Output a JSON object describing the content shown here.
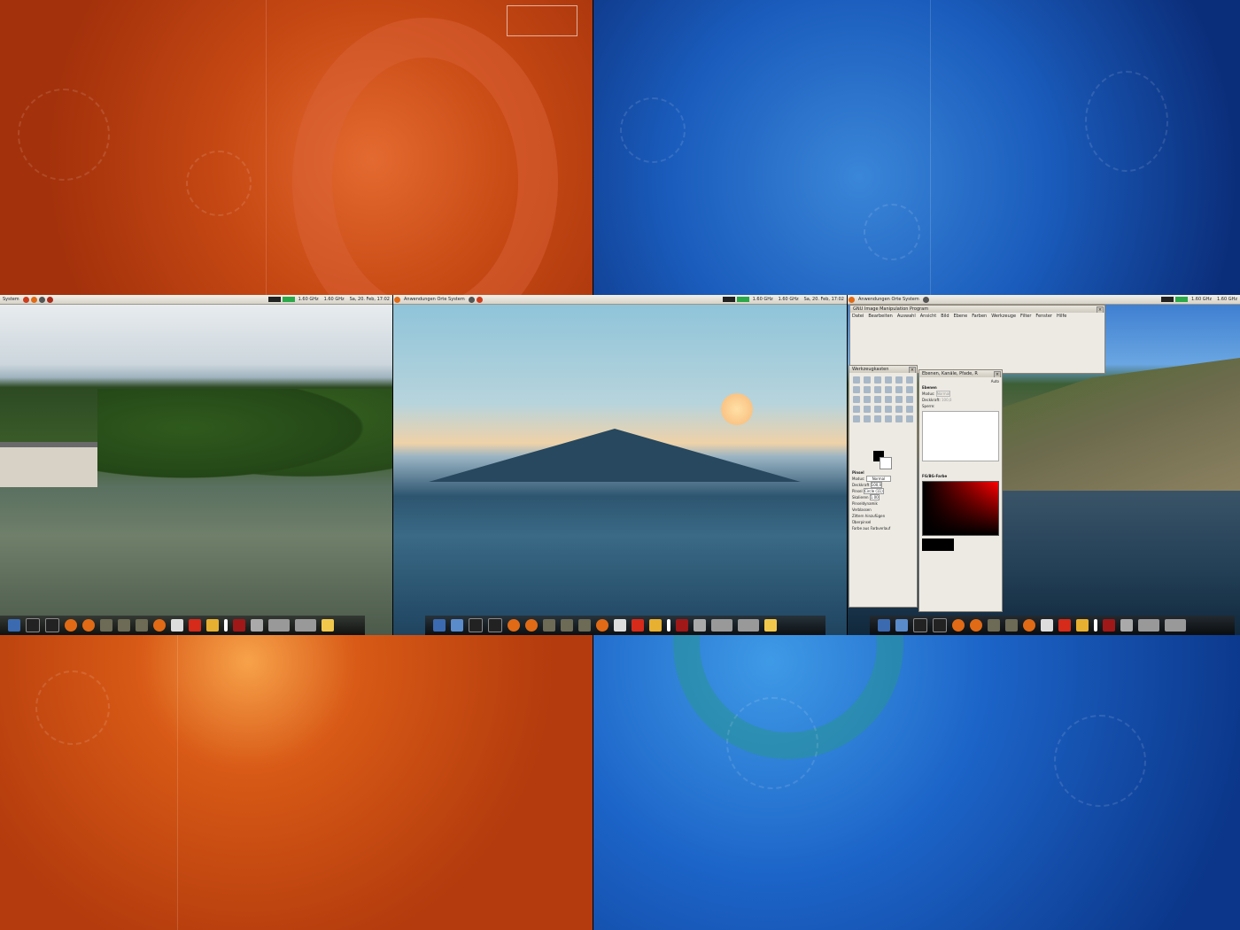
{
  "panels": [
    {
      "left": "System",
      "clock": "Sa, 20. Feb, 17:02",
      "cpu1": "1.60 GHz",
      "cpu2": "1.60 GHz"
    },
    {
      "left": "Anwendungen   Orte   System",
      "clock": "Sa, 20. Feb, 17:02",
      "cpu1": "1.60 GHz",
      "cpu2": "1.60 GHz"
    },
    {
      "left": "Anwendungen   Orte   System",
      "clock": "",
      "cpu1": "1.60 GHz",
      "cpu2": "1.60 GHz"
    }
  ],
  "gimp": {
    "title": "GNU Image Manipulation Program",
    "menu": [
      "Datei",
      "Bearbeiten",
      "Auswahl",
      "Ansicht",
      "Bild",
      "Ebene",
      "Farben",
      "Werkzeuge",
      "Filter",
      "Fenster",
      "Hilfe"
    ],
    "toolbox_title": "Werkzeugkasten",
    "tool_section": "Pinsel",
    "mode_label": "Modus:",
    "mode_value": "Normal",
    "opacity_label": "Deckkraft",
    "opacity_value": "100,0",
    "brush_label": "Pinsel",
    "brush_value": "Circle (11)",
    "scale_label": "Skalieren",
    "scale_value": "1.00",
    "options": [
      "Pinseldynamik",
      "Verblassen",
      "Zittern hinzufügen",
      "Überpinsel",
      "Farbe aus Farbverlauf"
    ],
    "layers_title": "Ebenen, Kanäle, Pfade, R",
    "layers_auto": "Auto",
    "layers_label": "Ebenen",
    "layers_mode_label": "Modus:",
    "layers_mode_value": "Normal",
    "layers_opacity_label": "Deckkraft:",
    "layers_opacity_value": "100,0",
    "layers_lock_label": "Sperre:",
    "color_label": "FG/BG-Farbe"
  },
  "icons": {
    "dock": [
      "disk-icon",
      "bird-icon",
      "terminal-icon",
      "terminal-icon",
      "firefox-icon",
      "firefox-icon",
      "turtle-icon",
      "turtle-icon",
      "turtle-icon",
      "ubuntu-icon",
      "chef-icon",
      "power-icon",
      "folder-icon",
      "down-icon",
      "image-icon",
      "trash-icon",
      "screen-icon",
      "workspace-icon",
      "lock-icon"
    ]
  },
  "colors": {
    "orange": "#c84a14",
    "blue": "#1a5cbc"
  }
}
